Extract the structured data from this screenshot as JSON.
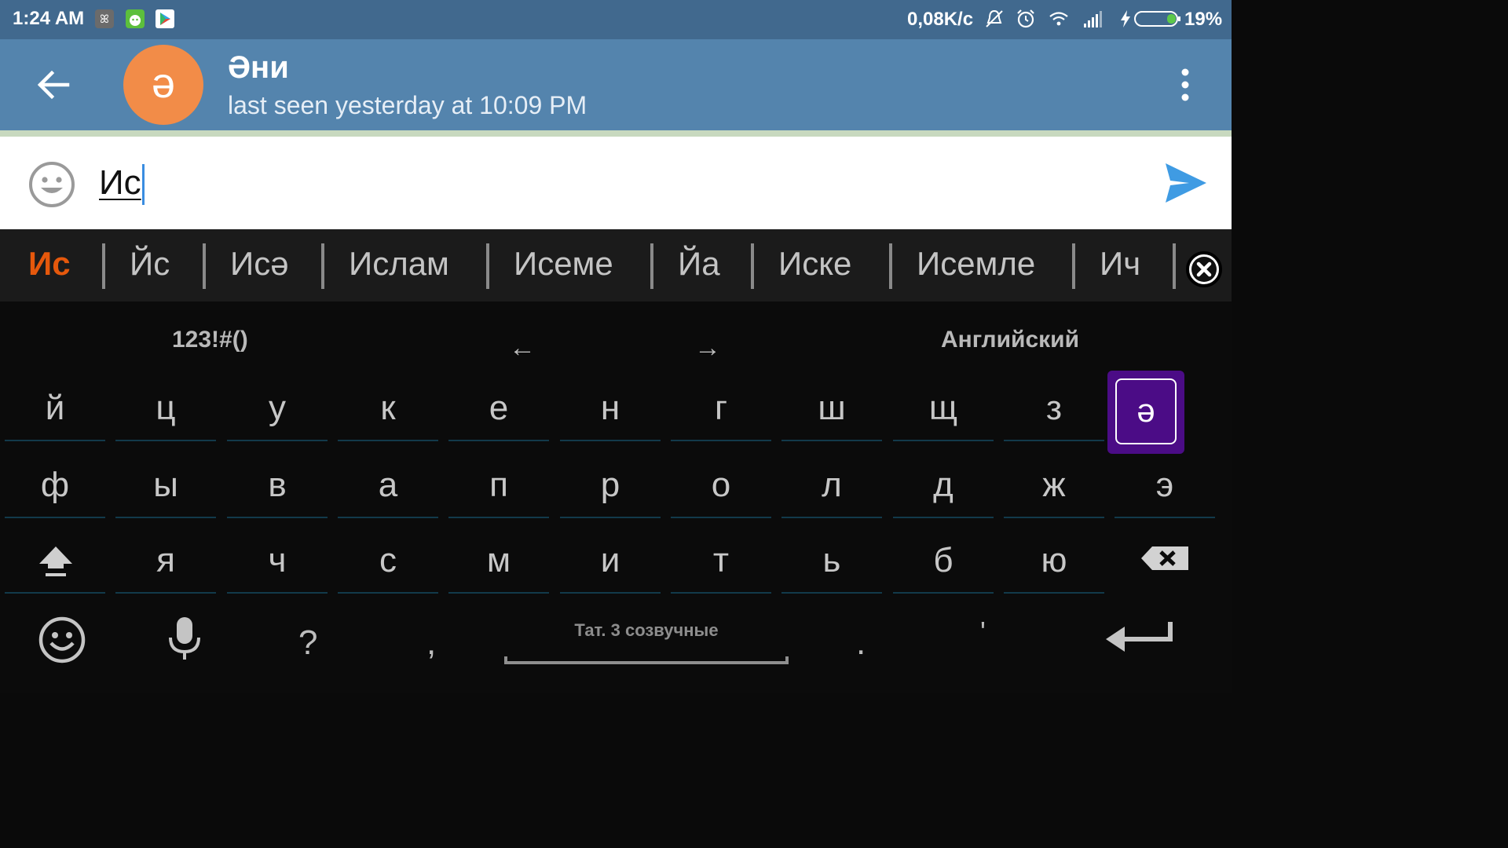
{
  "status_bar": {
    "time": "1:24 AM",
    "speed": "0,08K/c",
    "battery_pct": "19%",
    "icons": [
      "app-notification-icon",
      "android-icon",
      "play-store-icon",
      "mute-icon",
      "alarm-icon",
      "wifi-icon",
      "signal-icon",
      "charging-icon",
      "battery-icon"
    ]
  },
  "header": {
    "avatar_letter": "ә",
    "name": "Әни",
    "status": "last seen yesterday at 10:09 PM",
    "avatar_color": "#f28c48"
  },
  "input": {
    "value": "Ис"
  },
  "suggestions": {
    "active": "Ис",
    "items": [
      "Йс",
      "Исә",
      "Ислам",
      "Исеме",
      "Йа",
      "Иске",
      "Исемле",
      "Ич"
    ]
  },
  "keyboard": {
    "topbar": {
      "symbols": "123!#()",
      "left_arrow": "←",
      "right_arrow": "→",
      "language": "Английский"
    },
    "row1": [
      "й",
      "ц",
      "у",
      "к",
      "е",
      "н",
      "г",
      "ш",
      "щ",
      "з"
    ],
    "highlight_key": "ә",
    "row2": [
      "ф",
      "ы",
      "в",
      "а",
      "п",
      "р",
      "о",
      "л",
      "д",
      "ж",
      "э"
    ],
    "row3": [
      "я",
      "ч",
      "с",
      "м",
      "и",
      "т",
      "ь",
      "б",
      "ю"
    ],
    "bottom": {
      "question": "?",
      "comma": ",",
      "space_label": "Тат. 3 созвучные",
      "period": ".",
      "apostrophe": "'"
    },
    "accent_color": "#4b0c86"
  }
}
